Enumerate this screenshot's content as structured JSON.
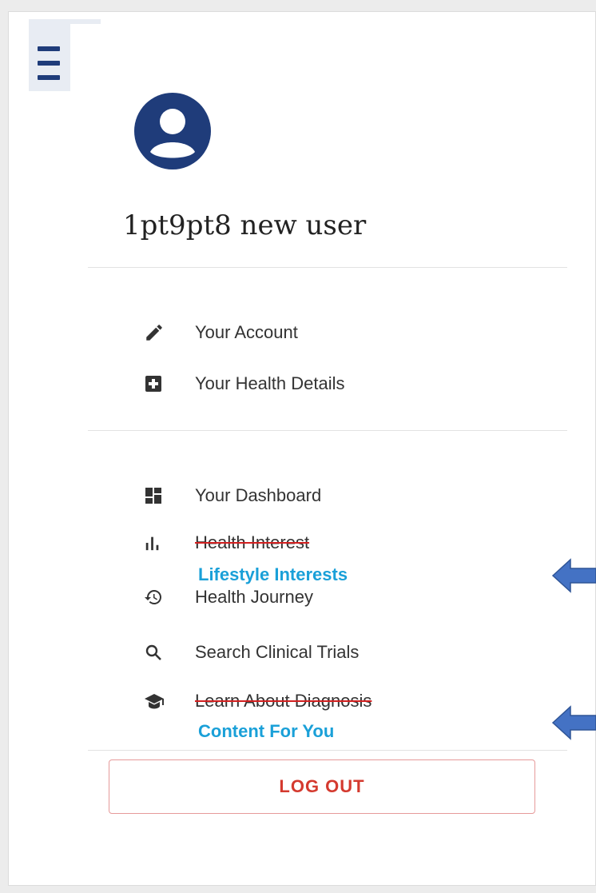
{
  "user": {
    "name": "1pt9pt8 new user"
  },
  "account_menu": [
    {
      "label": "Your Account",
      "icon": "pencil-icon"
    },
    {
      "label": "Your Health Details",
      "icon": "medical-plus-icon"
    }
  ],
  "nav_menu": [
    {
      "label": "Your Dashboard",
      "icon": "dashboard-icon"
    },
    {
      "label": "Health Interest",
      "icon": "bar-chart-icon",
      "struck": true,
      "replacement": "Lifestyle Interests"
    },
    {
      "label": "Health Journey",
      "icon": "history-icon"
    },
    {
      "label": "Search Clinical Trials",
      "icon": "search-icon"
    },
    {
      "label": "Learn About Diagnosis",
      "icon": "graduation-cap-icon",
      "struck": true,
      "replacement": "Content For You"
    }
  ],
  "logout": {
    "label": "LOG OUT"
  },
  "colors": {
    "brand": "#1f3c7a",
    "replacement_text": "#1aa0d8",
    "strike": "#d32020",
    "logout": "#d43a2f",
    "annotation_arrow": "#4472c4"
  }
}
